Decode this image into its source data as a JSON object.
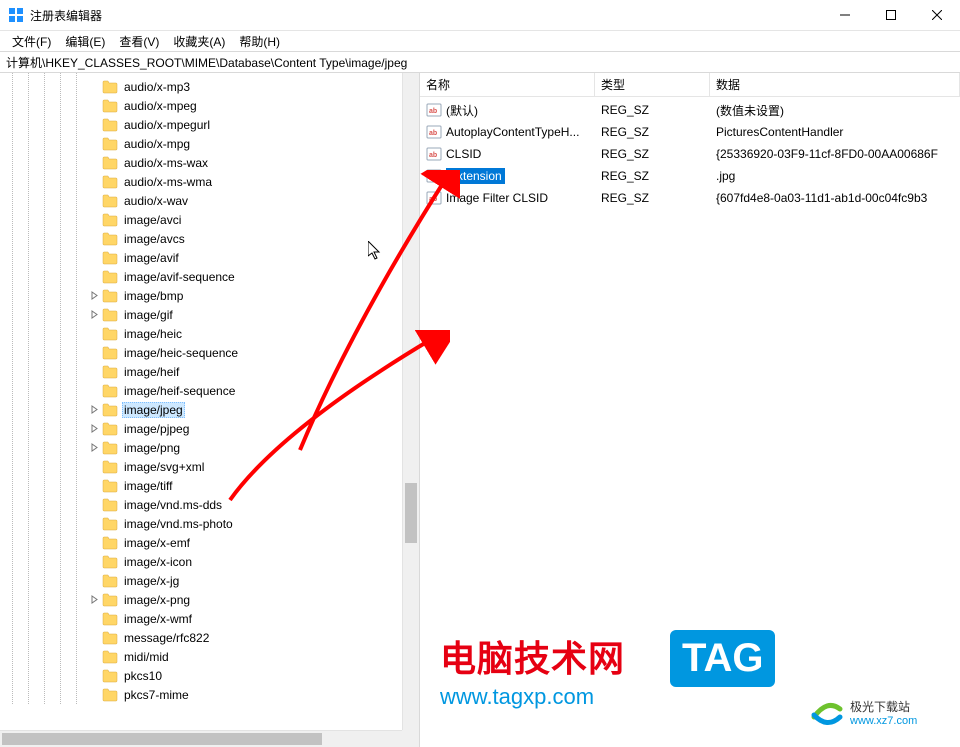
{
  "window": {
    "title": "注册表编辑器"
  },
  "menu": {
    "file": "文件(F)",
    "edit": "编辑(E)",
    "view": "查看(V)",
    "favorites": "收藏夹(A)",
    "help": "帮助(H)"
  },
  "address": "计算机\\HKEY_CLASSES_ROOT\\MIME\\Database\\Content Type\\image/jpeg",
  "tree": {
    "items": [
      {
        "label": "audio/x-mp3",
        "depth": 6,
        "expander": "none",
        "sel": false
      },
      {
        "label": "audio/x-mpeg",
        "depth": 6,
        "expander": "none",
        "sel": false
      },
      {
        "label": "audio/x-mpegurl",
        "depth": 6,
        "expander": "none",
        "sel": false
      },
      {
        "label": "audio/x-mpg",
        "depth": 6,
        "expander": "none",
        "sel": false
      },
      {
        "label": "audio/x-ms-wax",
        "depth": 6,
        "expander": "none",
        "sel": false
      },
      {
        "label": "audio/x-ms-wma",
        "depth": 6,
        "expander": "none",
        "sel": false
      },
      {
        "label": "audio/x-wav",
        "depth": 6,
        "expander": "none",
        "sel": false
      },
      {
        "label": "image/avci",
        "depth": 6,
        "expander": "none",
        "sel": false
      },
      {
        "label": "image/avcs",
        "depth": 6,
        "expander": "none",
        "sel": false
      },
      {
        "label": "image/avif",
        "depth": 6,
        "expander": "none",
        "sel": false
      },
      {
        "label": "image/avif-sequence",
        "depth": 6,
        "expander": "none",
        "sel": false
      },
      {
        "label": "image/bmp",
        "depth": 6,
        "expander": "closed",
        "sel": false
      },
      {
        "label": "image/gif",
        "depth": 6,
        "expander": "closed",
        "sel": false
      },
      {
        "label": "image/heic",
        "depth": 6,
        "expander": "none",
        "sel": false
      },
      {
        "label": "image/heic-sequence",
        "depth": 6,
        "expander": "none",
        "sel": false
      },
      {
        "label": "image/heif",
        "depth": 6,
        "expander": "none",
        "sel": false
      },
      {
        "label": "image/heif-sequence",
        "depth": 6,
        "expander": "none",
        "sel": false
      },
      {
        "label": "image/jpeg",
        "depth": 6,
        "expander": "closed",
        "sel": true
      },
      {
        "label": "image/pjpeg",
        "depth": 6,
        "expander": "closed",
        "sel": false
      },
      {
        "label": "image/png",
        "depth": 6,
        "expander": "closed",
        "sel": false
      },
      {
        "label": "image/svg+xml",
        "depth": 6,
        "expander": "none",
        "sel": false
      },
      {
        "label": "image/tiff",
        "depth": 6,
        "expander": "none",
        "sel": false
      },
      {
        "label": "image/vnd.ms-dds",
        "depth": 6,
        "expander": "none",
        "sel": false
      },
      {
        "label": "image/vnd.ms-photo",
        "depth": 6,
        "expander": "none",
        "sel": false
      },
      {
        "label": "image/x-emf",
        "depth": 6,
        "expander": "none",
        "sel": false
      },
      {
        "label": "image/x-icon",
        "depth": 6,
        "expander": "none",
        "sel": false
      },
      {
        "label": "image/x-jg",
        "depth": 6,
        "expander": "none",
        "sel": false
      },
      {
        "label": "image/x-png",
        "depth": 6,
        "expander": "closed",
        "sel": false
      },
      {
        "label": "image/x-wmf",
        "depth": 6,
        "expander": "none",
        "sel": false
      },
      {
        "label": "message/rfc822",
        "depth": 6,
        "expander": "none",
        "sel": false
      },
      {
        "label": "midi/mid",
        "depth": 6,
        "expander": "none",
        "sel": false
      },
      {
        "label": "pkcs10",
        "depth": 6,
        "expander": "none",
        "sel": false
      },
      {
        "label": "pkcs7-mime",
        "depth": 6,
        "expander": "none",
        "sel": false
      }
    ]
  },
  "list": {
    "columns": {
      "name": "名称",
      "type": "类型",
      "data": "数据"
    },
    "rows": [
      {
        "name": "(默认)",
        "type": "REG_SZ",
        "data": "(数值未设置)",
        "sel": false,
        "ellips": false
      },
      {
        "name": "AutoplayContentTypeH...",
        "type": "REG_SZ",
        "data": "PicturesContentHandler",
        "sel": false,
        "ellips": true
      },
      {
        "name": "CLSID",
        "type": "REG_SZ",
        "data": "{25336920-03F9-11cf-8FD0-00AA00686F",
        "sel": false,
        "ellips": false
      },
      {
        "name": "Extension",
        "type": "REG_SZ",
        "data": ".jpg",
        "sel": true,
        "ellips": false
      },
      {
        "name": "Image Filter CLSID",
        "type": "REG_SZ",
        "data": "{607fd4e8-0a03-11d1-ab1d-00c04fc9b3",
        "sel": false,
        "ellips": false
      }
    ]
  },
  "watermarks": {
    "brand_cn": "电脑技术网",
    "brand_url": "www.tagxp.com",
    "tag": "TAG",
    "site2_name": "极光下载站",
    "site2_url": "www.xz7.com"
  }
}
